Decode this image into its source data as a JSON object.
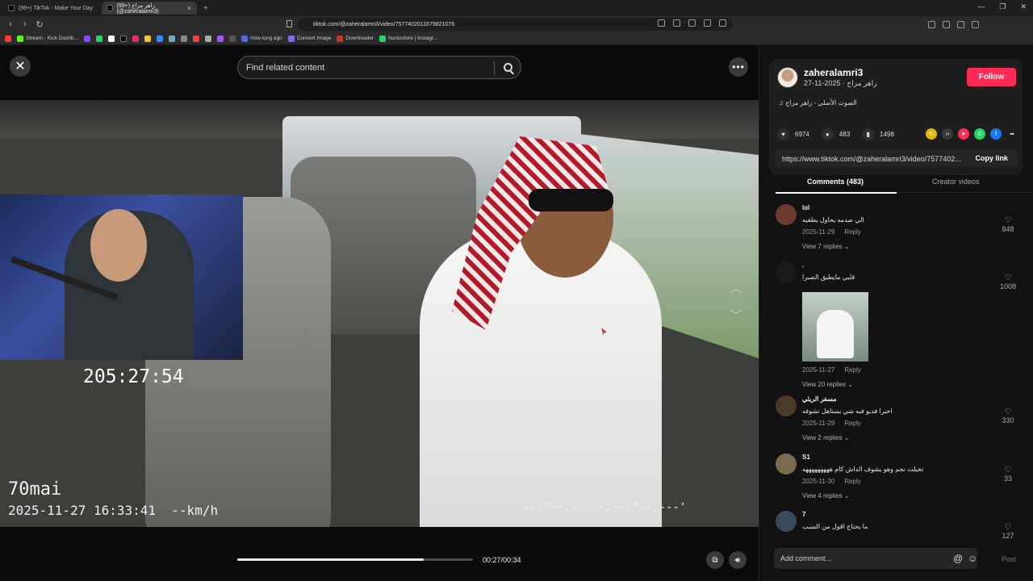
{
  "browser": {
    "tabs": [
      {
        "title": "(99+) TikTok - Make Your Day"
      },
      {
        "title": "(99+) زاهر مزاج (@zaheralamri3)"
      }
    ],
    "url": "tiktok.com/@zaheralamri3/video/7577402011679821076",
    "bookmarks": [
      "Stream - Kick Dashb...",
      "How long ago",
      "Convert Image",
      "Downloader",
      "huntostore | Instagr..."
    ]
  },
  "video": {
    "search_placeholder": "Find related content",
    "overlay_timer": "205:27:54",
    "dashcam_brand": "70mai",
    "dashcam_stamp": "2025-11-27 16:33:41  --km/h",
    "dashcam_gps": "---°--.---'-,---°--.---'",
    "time": "00:27/00:34",
    "progress": 0.79
  },
  "creator": {
    "username": "zaheralamri3",
    "subline": "زاهر مزاج · 2025-11-27",
    "follow_label": "Follow",
    "music": "الصوت الأصلي - زاهر مزاج"
  },
  "stats": {
    "likes": "6974",
    "comments": "483",
    "saves": "1498"
  },
  "share": {
    "link": "https://www.tiktok.com/@zaheralamri3/video/7577402...",
    "copy_label": "Copy link"
  },
  "panel_tabs": {
    "comments": "Comments (483)",
    "creator": "Creator videos"
  },
  "comments": [
    {
      "name": "lol",
      "text": "الي صدمه يحاول يطقيه",
      "date": "2025-11-29",
      "reply": "Reply",
      "replies": "View 7 replies",
      "likes": "848",
      "avatar_color": "#6b3a2a"
    },
    {
      "name": ".",
      "text": "قلبي مايطيق الصبرا",
      "date": "2025-11-27",
      "reply": "Reply",
      "replies": "View 20 replies",
      "likes": "1008",
      "avatar_color": "#1a1a1a"
    },
    {
      "name": "مسفر الريثي",
      "text": "اخيرا فديو فيه شي يستاهل نشوفه",
      "date": "2025-11-29",
      "reply": "Reply",
      "replies": "View 2 replies",
      "likes": "330",
      "avatar_color": "#4a3a2a"
    },
    {
      "name": "S1",
      "text": "تخيلت نجم وهو يشوف الداش كام هههههههههه",
      "date": "2025-11-30",
      "reply": "Reply",
      "replies": "View 4 replies",
      "likes": "33",
      "avatar_color": "#7a6a50"
    },
    {
      "name": "7",
      "text": "ما يحتاج اقول من السبب",
      "likes": "127",
      "avatar_color": "#3a4a5a"
    }
  ],
  "composer": {
    "placeholder": "Add comment...",
    "post_label": "Post"
  },
  "colors": {
    "follow": "#fe2c55",
    "background": "#121212"
  }
}
